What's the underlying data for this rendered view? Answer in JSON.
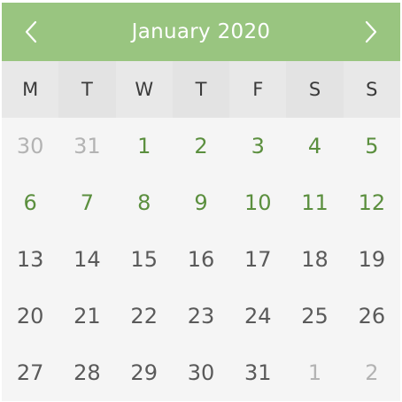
{
  "header": {
    "title": "January 2020",
    "prev_icon": "chevron-left-icon",
    "next_icon": "chevron-right-icon"
  },
  "colors": {
    "header_bg": "#99c580",
    "current_month_upcoming": "#5b8f3e",
    "current_month_default": "#5a5a5a",
    "other_month": "#b3b3b3"
  },
  "weekdays": [
    "M",
    "T",
    "W",
    "T",
    "F",
    "S",
    "S"
  ],
  "days": [
    {
      "label": "30",
      "style": "muted"
    },
    {
      "label": "31",
      "style": "muted"
    },
    {
      "label": "1",
      "style": "green"
    },
    {
      "label": "2",
      "style": "green"
    },
    {
      "label": "3",
      "style": "green"
    },
    {
      "label": "4",
      "style": "green"
    },
    {
      "label": "5",
      "style": "green"
    },
    {
      "label": "6",
      "style": "green"
    },
    {
      "label": "7",
      "style": "green"
    },
    {
      "label": "8",
      "style": "green"
    },
    {
      "label": "9",
      "style": "green"
    },
    {
      "label": "10",
      "style": "green"
    },
    {
      "label": "11",
      "style": "green"
    },
    {
      "label": "12",
      "style": "green"
    },
    {
      "label": "13",
      "style": "normal"
    },
    {
      "label": "14",
      "style": "normal"
    },
    {
      "label": "15",
      "style": "normal"
    },
    {
      "label": "16",
      "style": "normal"
    },
    {
      "label": "17",
      "style": "normal"
    },
    {
      "label": "18",
      "style": "normal"
    },
    {
      "label": "19",
      "style": "normal"
    },
    {
      "label": "20",
      "style": "normal"
    },
    {
      "label": "21",
      "style": "normal"
    },
    {
      "label": "22",
      "style": "normal"
    },
    {
      "label": "23",
      "style": "normal"
    },
    {
      "label": "24",
      "style": "normal"
    },
    {
      "label": "25",
      "style": "normal"
    },
    {
      "label": "26",
      "style": "normal"
    },
    {
      "label": "27",
      "style": "normal"
    },
    {
      "label": "28",
      "style": "normal"
    },
    {
      "label": "29",
      "style": "normal"
    },
    {
      "label": "30",
      "style": "normal"
    },
    {
      "label": "31",
      "style": "normal"
    },
    {
      "label": "1",
      "style": "muted"
    },
    {
      "label": "2",
      "style": "muted"
    }
  ]
}
